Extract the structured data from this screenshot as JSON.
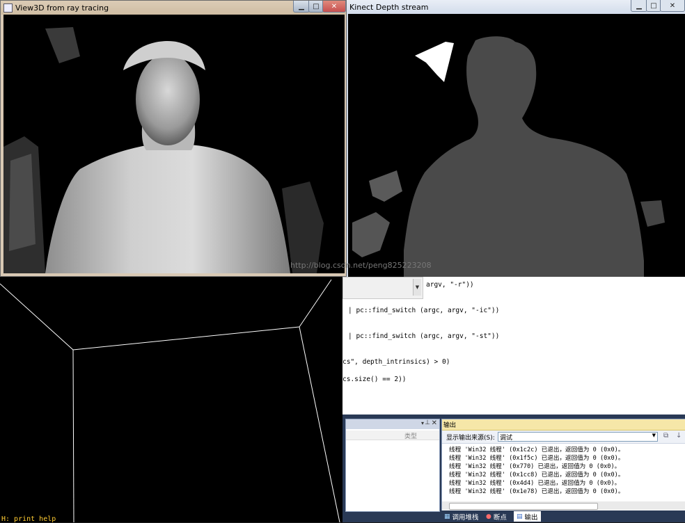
{
  "windows": {
    "ray": {
      "title": "View3D from ray tracing"
    },
    "depth": {
      "title": "Kinect Depth stream"
    }
  },
  "watermark": "http://blog.csdn.net/peng825223208",
  "editor": {
    "lines": [
      {
        "text": "argv, \"-r\"))"
      },
      {
        "text": "| pc::find_switch (argc, argv, \"-ic\"))"
      },
      {
        "text": "| pc::find_switch (argc, argv, \"-st\"))"
      },
      {
        "text": "cs\", depth_intrinsics) > 0)"
      },
      {
        "text": "cs.size() == 2))"
      }
    ]
  },
  "left_panel": {
    "column": "类型"
  },
  "output": {
    "title": "输出",
    "source_label": "显示输出来源(S):",
    "source_value": "调试",
    "lines": [
      "线程 'Win32 线程' (0x1c2c) 已退出，返回值为 0 (0x0)。",
      "线程 'Win32 线程' (0x1f5c) 已退出，返回值为 0 (0x0)。",
      "线程 'Win32 线程' (0x770) 已退出，返回值为 0 (0x0)。",
      "线程 'Win32 线程' (0x1cc8) 已退出，返回值为 0 (0x0)。",
      "线程 'Win32 线程' (0x4d4) 已退出，返回值为 0 (0x0)。",
      "线程 'Win32 线程' (0x1e78) 已退出，返回值为 0 (0x0)。"
    ]
  },
  "tabs": [
    "调用堆栈",
    "断点",
    "输出"
  ],
  "help_text": "H: print help",
  "icons": {
    "minimize": "minimize-icon",
    "maximize": "maximize-icon",
    "close": "close-icon"
  },
  "colors": {
    "vs_dark": "#293955",
    "output_header": "#f6e7a8",
    "close_red": "#c75050"
  }
}
